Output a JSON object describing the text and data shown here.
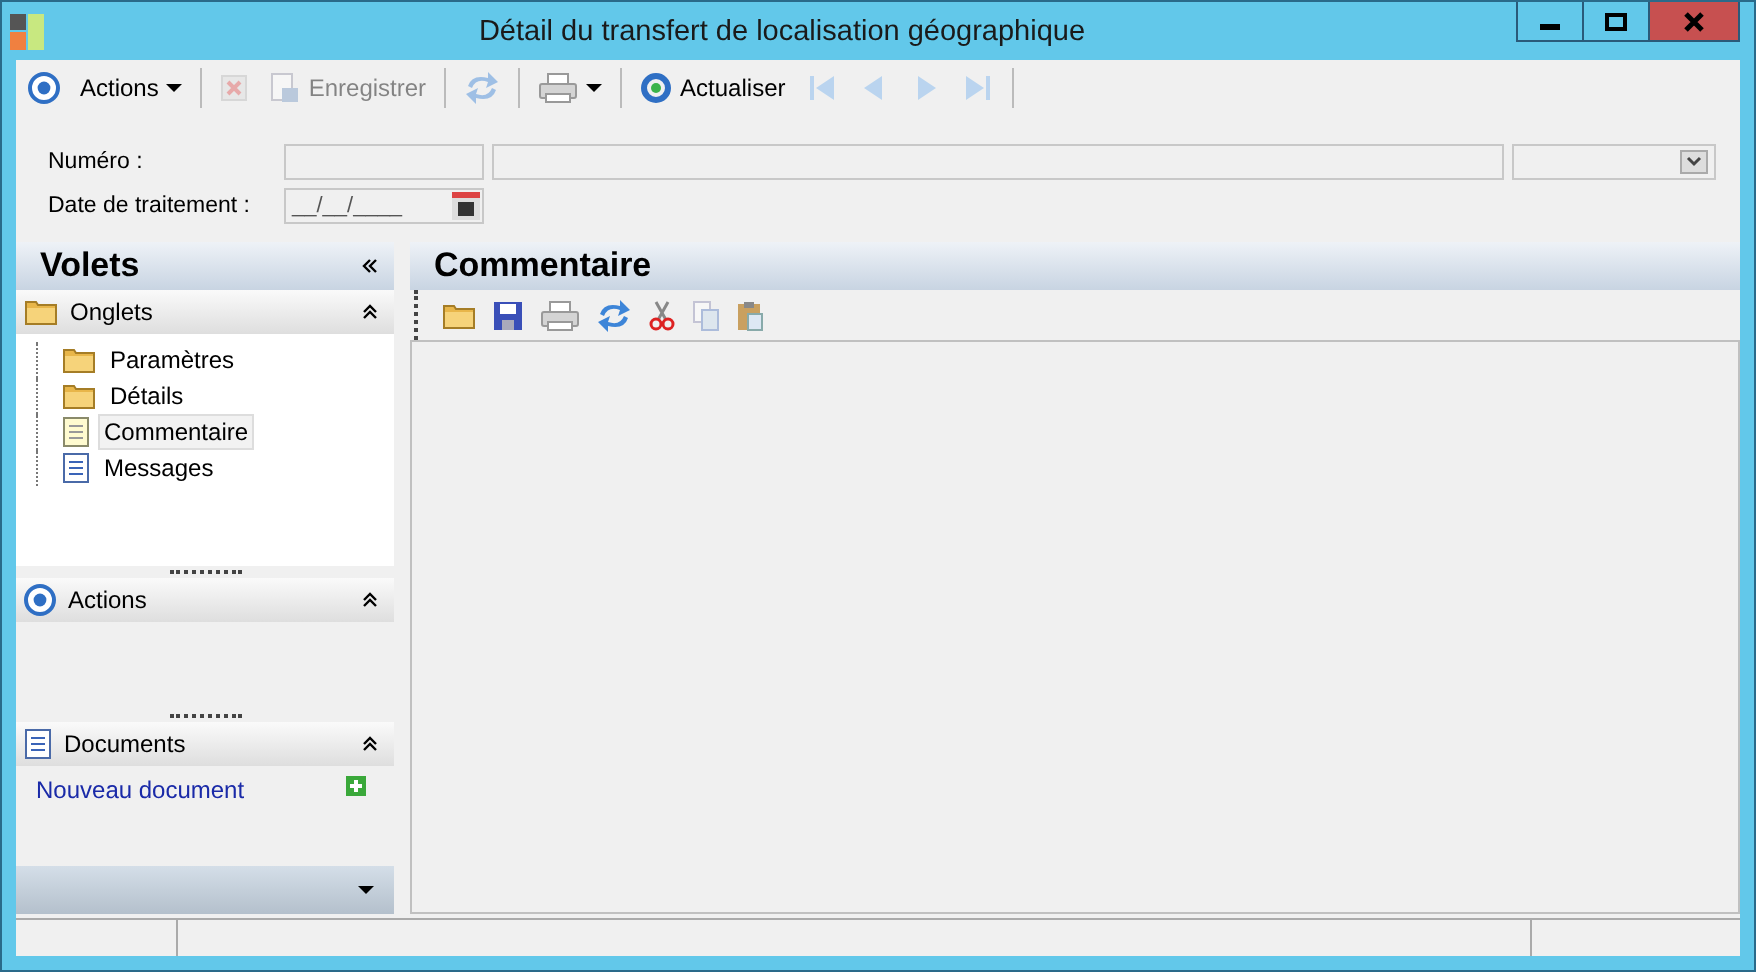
{
  "window": {
    "title": "Détail du transfert de localisation géographique"
  },
  "toolbar": [
    {
      "kind": "target",
      "disabled": false
    },
    {
      "kind": "menu",
      "label": "Actions",
      "disabled": false
    },
    {
      "kind": "separator"
    },
    {
      "kind": "delete",
      "disabled": true
    },
    {
      "kind": "save",
      "label": "Enregistrer",
      "disabled": true
    },
    {
      "kind": "separator"
    },
    {
      "kind": "sync",
      "disabled": true
    },
    {
      "kind": "separator"
    },
    {
      "kind": "print",
      "disabled": false
    },
    {
      "kind": "separator"
    },
    {
      "kind": "refresh",
      "label": "Actualiser",
      "disabled": false
    },
    {
      "kind": "first",
      "disabled": true
    },
    {
      "kind": "prev",
      "disabled": true
    },
    {
      "kind": "next",
      "disabled": true
    },
    {
      "kind": "last",
      "disabled": true
    },
    {
      "kind": "separator"
    }
  ],
  "form": {
    "numero_label": "Numéro :",
    "date_label": "Date de traitement :",
    "date_value": "__/__/____"
  },
  "sidebar": {
    "title": "Volets",
    "sections": [
      {
        "kind": "folder",
        "title": "Onglets",
        "expanded": true,
        "children": [
          {
            "kind": "folder",
            "label": "Paramètres",
            "selected": false
          },
          {
            "kind": "folder",
            "label": "Détails",
            "selected": false
          },
          {
            "kind": "note",
            "label": "Commentaire",
            "selected": true
          },
          {
            "kind": "doc",
            "label": "Messages",
            "selected": false
          }
        ]
      },
      {
        "kind": "target",
        "title": "Actions",
        "expanded": true
      },
      {
        "kind": "doc",
        "title": "Documents",
        "expanded": true,
        "link": "Nouveau document"
      }
    ]
  },
  "main": {
    "title": "Commentaire"
  }
}
